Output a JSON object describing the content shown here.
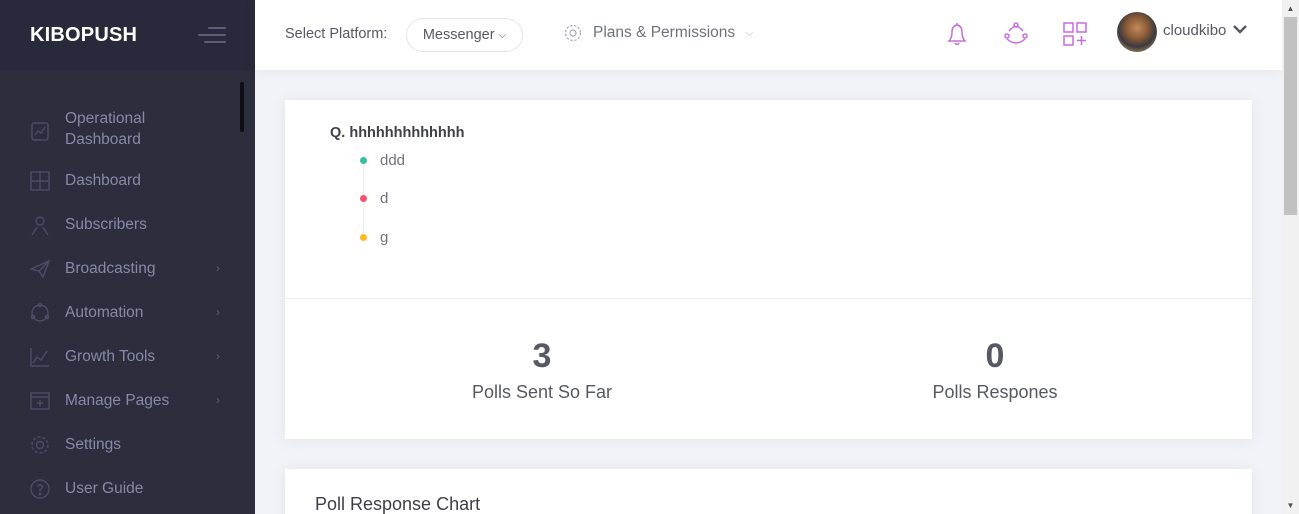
{
  "brand": {
    "name": "KIBOPUSH"
  },
  "sidebar": {
    "items": [
      {
        "label": "Operational\nDashboard",
        "icon": "chart-board-icon",
        "has_submenu": false
      },
      {
        "label": "Dashboard",
        "icon": "grid-icon",
        "has_submenu": false
      },
      {
        "label": "Subscribers",
        "icon": "users-icon",
        "has_submenu": false
      },
      {
        "label": "Broadcasting",
        "icon": "paper-plane-icon",
        "has_submenu": true
      },
      {
        "label": "Automation",
        "icon": "automation-icon",
        "has_submenu": true
      },
      {
        "label": "Growth Tools",
        "icon": "line-chart-icon",
        "has_submenu": true
      },
      {
        "label": "Manage Pages",
        "icon": "add-page-icon",
        "has_submenu": true
      },
      {
        "label": "Settings",
        "icon": "gear-icon",
        "has_submenu": false
      },
      {
        "label": "User Guide",
        "icon": "question-circle-icon",
        "has_submenu": false
      }
    ],
    "submenu_arrow": "›"
  },
  "header": {
    "select_platform_label": "Select Platform:",
    "platform_value": "Messenger",
    "plans_label": "Plans & Permissions",
    "user_name": "cloudkibo",
    "icons": [
      "bell-icon",
      "share-network-icon",
      "apps-add-icon"
    ],
    "accent_color": "#c66be0"
  },
  "poll": {
    "question": "Q. hhhhhhhhhhhhh",
    "options": [
      {
        "text": "ddd",
        "color": "#34bfa3"
      },
      {
        "text": "d",
        "color": "#f4516c"
      },
      {
        "text": "g",
        "color": "#ffb822"
      }
    ],
    "stats": [
      {
        "value": "3",
        "caption": "Polls Sent So Far"
      },
      {
        "value": "0",
        "caption": "Polls Respones"
      }
    ]
  },
  "chart_section": {
    "title": "Poll Response Chart"
  }
}
